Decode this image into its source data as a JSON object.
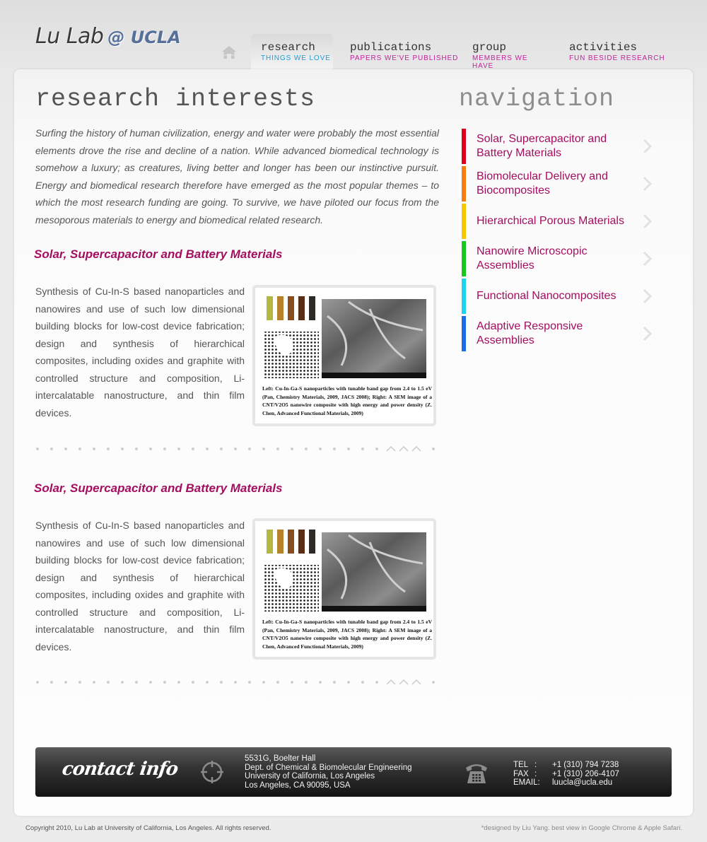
{
  "header": {
    "logo_main": "Lu Lab",
    "logo_sub": "@ UCLA",
    "home_icon": "home-icon",
    "tabs": [
      {
        "title": "research",
        "subtitle": "Things We Love",
        "active": true
      },
      {
        "title": "publications",
        "subtitle": "Papers We've Published",
        "active": false
      },
      {
        "title": "group",
        "subtitle": "Members We Have",
        "active": false
      },
      {
        "title": "activities",
        "subtitle": "Fun Beside Research",
        "active": false
      }
    ]
  },
  "main": {
    "heading": "research interests",
    "intro": "Surfing the history of human civilization, energy and water were probably the most essential elements drove the rise and decline of a nation.  While advanced biomedical technology is somehow a luxury; as creatures, living better and longer has been our instinctive pursuit. Energy and biomedical research therefore have emerged as the most popular themes – to which the most research funding are going.  To survive, we have piloted our focus from the mesoporous materials to energy and biomedical related research.",
    "sections": [
      {
        "title": "Solar, Supercapacitor and Battery Materials",
        "text": "Synthesis of Cu-In-S based nanoparticles and nanowires and use of such low dimensional building blocks for low-cost device fabrication; design and synthesis of hierarchical composites, including oxides and graphite with controlled structure and composition, Li-intercalatable nanostructure, and thin film devices.",
        "caption": "Left: Cu-In-Ga-S nanoparticles with tunable band gap from 2.4  to 1.5 eV (Pan, Chemistry Materials, 2009, JACS 2008); Right: A SEM image of a CNT/V2O5 nanowire composite with high energy and power density (Z. Chen, Advanced Functional Materials, 2009)",
        "sem_strip": "NONE   SEI   20.0kV   X10,000   1μm   WD 8.4mm"
      },
      {
        "title": "Solar, Supercapacitor and Battery Materials",
        "text": "Synthesis of Cu-In-S based nanoparticles and nanowires and use of such low dimensional building blocks for low-cost device fabrication; design and synthesis of hierarchical composites, including oxides and graphite with controlled structure and composition, Li-intercalatable nanostructure, and thin film devices.",
        "caption": "Left: Cu-In-Ga-S nanoparticles with tunable band gap from 2.4  to 1.5 eV (Pan, Chemistry Materials, 2009, JACS 2008); Right: A SEM image of a CNT/V2O5 nanowire composite with high energy and power density (Z. Chen, Advanced Functional Materials, 2009)",
        "sem_strip": "NONE   SEI   20.0kV   X10,000   1μm   WD 8.4mm"
      }
    ],
    "divider_icon": "back-to-top-chevrons-icon"
  },
  "navigation": {
    "heading": "navigation",
    "items": [
      {
        "label": "Solar, Supercapacitor and Battery Materials",
        "color": "#e0001b"
      },
      {
        "label": "Biomolecular Delivery and Biocomposites",
        "color": "#f47e0f"
      },
      {
        "label": "Hierarchical Porous Materials",
        "color": "#f6c800"
      },
      {
        "label": "Nanowire Microscopic Assemblies",
        "color": "#16c81e"
      },
      {
        "label": "Functional Nanocomposites",
        "color": "#1ad4ec"
      },
      {
        "label": "Adaptive Responsive Assemblies",
        "color": "#1a6fe6"
      }
    ],
    "chevron_icon": "chevron-right-icon"
  },
  "contact": {
    "title": "contact info",
    "address": [
      "5531G, Boelter Hall",
      "Dept. of Chemical & Biomolecular Engineering",
      "University of California, Los Angeles",
      "Los Angeles, CA 90095, USA"
    ],
    "rows": [
      {
        "key": "TEL",
        "value": "+1 (310) 794 7238"
      },
      {
        "key": "FAX",
        "value": "+1 (310) 206-4107"
      },
      {
        "key": "EMAIL:",
        "value": "luucla@ucla.edu"
      }
    ],
    "separator": ":"
  },
  "footer": {
    "copyright": "Copyright 2010, Lu Lab at University of California, Los Angeles. All rights reserved.",
    "credit": "*designed by Liu Yang. best view in Google Chrome & Apple Safari."
  },
  "colors": {
    "accent": "#a30e60",
    "tab_active_sub": "#1aa0d8",
    "tab_sub": "#c0249b"
  }
}
